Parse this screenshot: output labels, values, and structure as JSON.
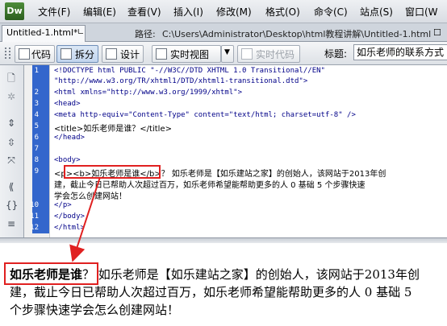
{
  "app": {
    "logo": "Dw"
  },
  "menu": [
    {
      "label": "文件(F)"
    },
    {
      "label": "编辑(E)"
    },
    {
      "label": "查看(V)"
    },
    {
      "label": "插入(I)"
    },
    {
      "label": "修改(M)"
    },
    {
      "label": "格式(O)"
    },
    {
      "label": "命令(C)"
    },
    {
      "label": "站点(S)"
    },
    {
      "label": "窗口(W"
    }
  ],
  "doc_tab": {
    "label": "Untitled-1.html*",
    "path_label": "路径:",
    "path": "C:\\Users\\Administrator\\Desktop\\html教程讲解\\Untitled-1.html",
    "close": "☐"
  },
  "toolbar": {
    "code": "代码",
    "split": "拆分",
    "design": "设计",
    "live_view": "实时视图",
    "live_code": "实时代码",
    "title_label": "标题:",
    "title_value": "如乐老师的联系方式"
  },
  "code_lines": [
    {
      "n": "1",
      "text": "<!DOCTYPE html PUBLIC \"-//W3C//DTD XHTML 1.0 Transitional//EN\""
    },
    {
      "n": "",
      "text": "\"http://www.w3.org/TR/xhtml1/DTD/xhtml1-transitional.dtd\">"
    },
    {
      "n": "2",
      "text": "<html xmlns=\"http://www.w3.org/1999/xhtml\">"
    },
    {
      "n": "3",
      "text": "<head>"
    },
    {
      "n": "4",
      "text": "<meta http-equiv=\"Content-Type\" content=\"text/html; charset=utf-8\" />"
    },
    {
      "n": "5",
      "text": "<title>如乐老师是谁？</title>"
    },
    {
      "n": "6",
      "text": "</head>"
    },
    {
      "n": "7",
      "text": ""
    },
    {
      "n": "8",
      "text": "<body>"
    },
    {
      "n": "9",
      "text": "<p><b>如乐老师是谁</b>？ 如乐老师是【如乐建站之家】的创始人，该网站于2013年创"
    },
    {
      "n": "",
      "text": "建，截止今日已帮助人次超过百万，如乐老师希望能帮助更多的人 0 基础 5 个步骤快速"
    },
    {
      "n": "",
      "text": "学会怎么创建网站！"
    },
    {
      "n": "10",
      "text": "</p>"
    },
    {
      "n": "11",
      "text": "</body>"
    },
    {
      "n": "12",
      "text": "</html>"
    },
    {
      "n": "13",
      "text": ""
    }
  ],
  "design_view": {
    "bold": "如乐老师是谁",
    "line1_rest": "？ 如乐老师是【如乐建站之家】的创始人，该网站于2013年创",
    "line2": "建，截止今日已帮助人次超过百万，如乐老师希望能帮助更多的人 0 基础 5",
    "line3": "个步骤快速学会怎么创建网站！"
  },
  "colors": {
    "highlight": "#e02020",
    "code_tag": "#000088"
  }
}
